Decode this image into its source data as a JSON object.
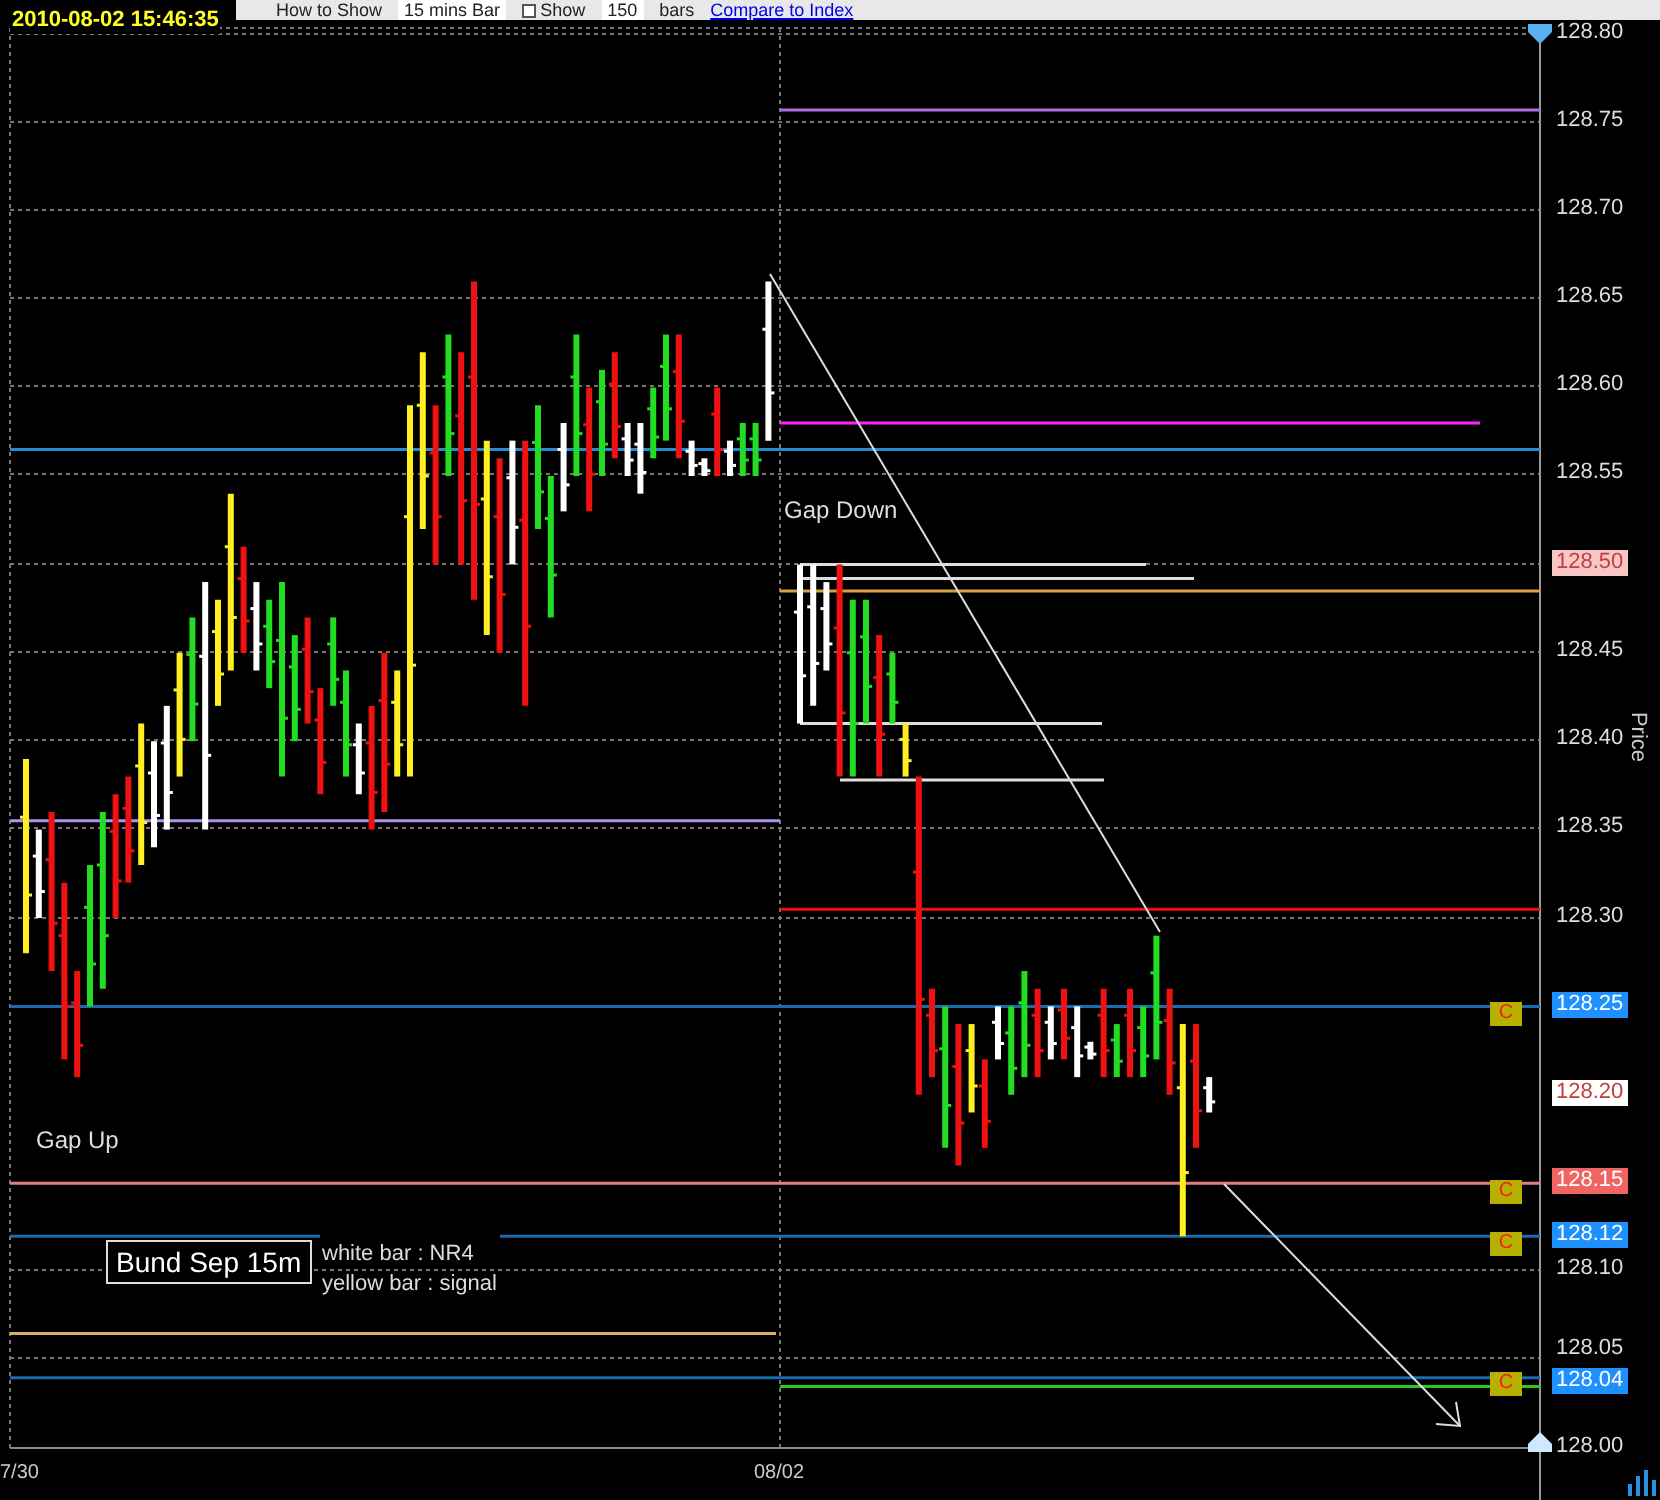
{
  "header": {
    "timestamp": "2010-08-02 15:46:35"
  },
  "toolbar": {
    "how_to_show_label": "How to Show",
    "interval": "15 mins Bar",
    "show_checkbox": {
      "label": "Show",
      "checked": false
    },
    "bar_count": "150",
    "bars_label": "bars",
    "compare_link": "Compare to Index"
  },
  "chart": {
    "price_axis": {
      "title": "Price",
      "ticks": [
        "128.80",
        "128.75",
        "128.70",
        "128.65",
        "128.60",
        "128.55",
        "128.45",
        "128.40",
        "128.35",
        "128.30",
        "128.10",
        "128.05",
        "128.00"
      ]
    },
    "price_badges": [
      {
        "label": "128.50",
        "color": "#f8c6c6"
      },
      {
        "label": "128.25",
        "color": "#1e90ff"
      },
      {
        "label": "128.20",
        "color": "#ffffff"
      },
      {
        "label": "128.15",
        "color": "#f06464"
      },
      {
        "label": "128.12",
        "color": "#1e90ff"
      },
      {
        "label": "128.04",
        "color": "#1e90ff"
      }
    ],
    "level_markers": [
      "C",
      "C",
      "C",
      "C"
    ],
    "date_labels": [
      "7/30",
      "08/02"
    ],
    "annotations": [
      "Gap Up",
      "Gap Down"
    ],
    "legend": {
      "title": "Bund Sep 15m",
      "lines": [
        "white bar : NR4",
        "yellow bar : signal"
      ]
    }
  }
}
